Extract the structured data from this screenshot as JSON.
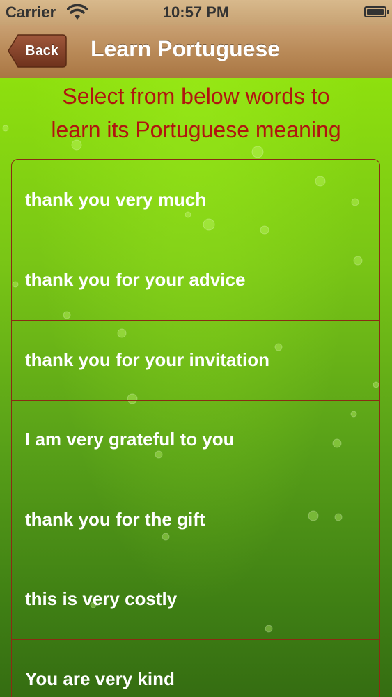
{
  "status_bar": {
    "carrier": "Carrier",
    "time": "10:57 PM",
    "wifi_icon": "wifi-icon",
    "battery_icon": "battery-icon"
  },
  "nav_bar": {
    "back_label": "Back",
    "title": "Learn Portuguese"
  },
  "instructions": {
    "line1": "Select from below words to",
    "line2": "learn its Portuguese meaning"
  },
  "words": [
    "thank you very much",
    "thank you for your advice",
    "thank you for your invitation",
    "I am very grateful to you",
    "thank you for the gift",
    "this is very costly",
    "You are very kind"
  ],
  "colors": {
    "instruction_text": "#b0160f",
    "nav_bar": "#b98a58",
    "background_green": "#79c516",
    "row_separator": "#8a2d13",
    "word_text": "#ffffff"
  }
}
